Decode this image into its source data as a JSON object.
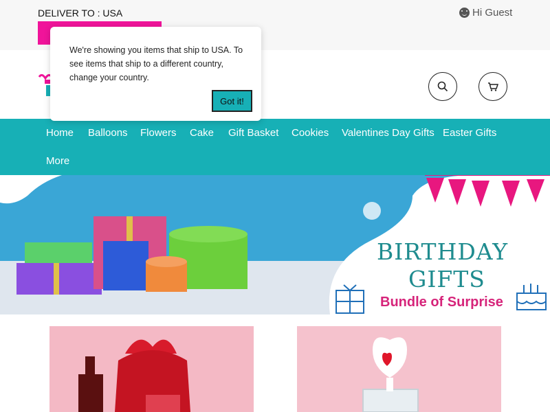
{
  "topbar": {
    "deliver_label": "DELIVER TO : USA",
    "greeting": "Hi Guest",
    "accent_color": "#f0149a"
  },
  "header": {
    "icons": [
      "logo-gift-icon",
      "search-icon",
      "cart-icon"
    ]
  },
  "nav": {
    "background_color": "#17b0b6",
    "items": [
      "Home",
      "Balloons",
      "Flowers",
      "Cake",
      "Gift Basket",
      "Cookies",
      "Valentines Day Gifts",
      "Easter Gifts",
      "More"
    ]
  },
  "banner": {
    "title_line1": "BIRTHDAY",
    "title_line2": "GIFTS",
    "subtitle": "Bundle of Surprise"
  },
  "popup": {
    "message": "We're showing you items that ship to USA. To see items that ship to a different country, change your country.",
    "button_label": "Got it!"
  }
}
